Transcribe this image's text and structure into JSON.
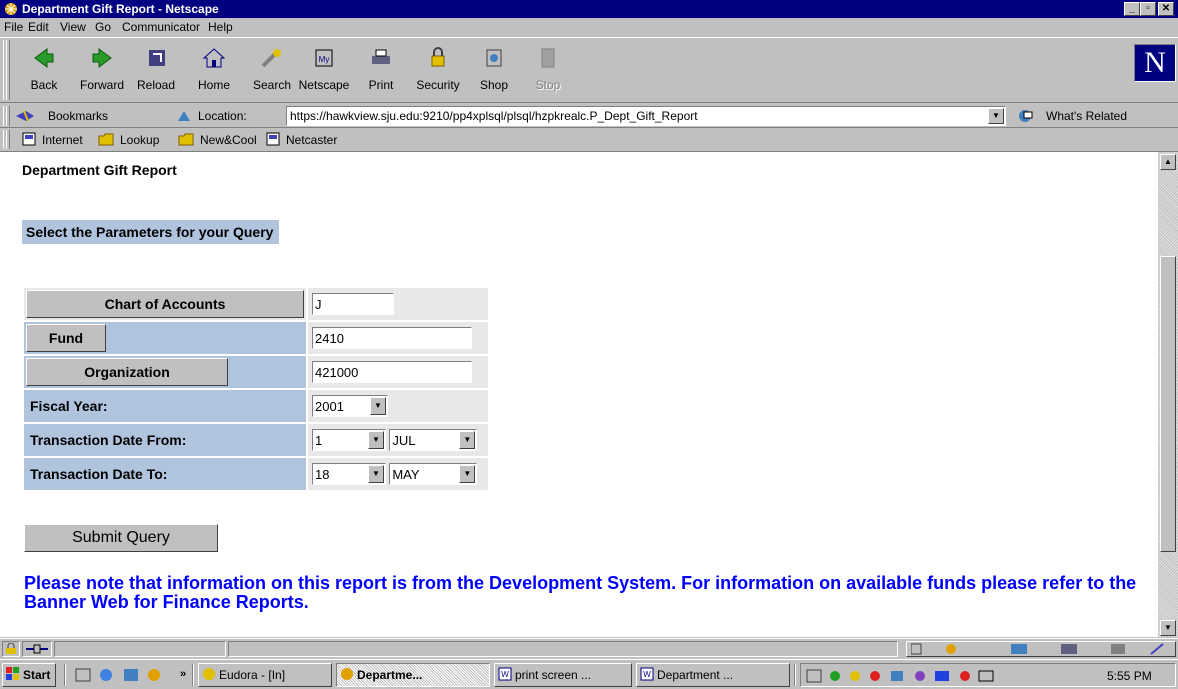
{
  "window": {
    "title": "Department Gift Report - Netscape"
  },
  "menu": [
    "File",
    "Edit",
    "View",
    "Go",
    "Communicator",
    "Help"
  ],
  "nav_buttons": [
    {
      "label": "Back",
      "icon": "back-arrow-icon"
    },
    {
      "label": "Forward",
      "icon": "forward-arrow-icon"
    },
    {
      "label": "Reload",
      "icon": "reload-icon"
    },
    {
      "label": "Home",
      "icon": "home-icon"
    },
    {
      "label": "Search",
      "icon": "search-icon"
    },
    {
      "label": "Netscape",
      "icon": "netscape-icon"
    },
    {
      "label": "Print",
      "icon": "print-icon"
    },
    {
      "label": "Security",
      "icon": "security-lock-icon"
    },
    {
      "label": "Shop",
      "icon": "shop-icon"
    },
    {
      "label": "Stop",
      "icon": "stop-icon"
    }
  ],
  "location": {
    "bookmarks_label": "Bookmarks",
    "location_label": "Location:",
    "url": "https://hawkview.sju.edu:9210/pp4xplsql/plsql/hzpkrealc.P_Dept_Gift_Report",
    "whats_related": "What's Related"
  },
  "personal_bar": [
    "Internet",
    "Lookup",
    "New&Cool",
    "Netcaster"
  ],
  "page": {
    "title": "Department Gift Report",
    "param_header": "Select the Parameters for your Query",
    "form": {
      "chart_label": "Chart of Accounts",
      "chart_value": "J",
      "fund_label": "Fund",
      "fund_value": "2410",
      "org_label": "Organization",
      "org_value": "421000",
      "fiscal_label": "Fiscal Year:",
      "fiscal_value": "2001",
      "from_label": "Transaction Date From:",
      "from_day": "1",
      "from_month": "JUL",
      "to_label": "Transaction Date To:",
      "to_day": "18",
      "to_month": "MAY"
    },
    "submit_label": "Submit Query",
    "note": "Please note that information on this report is from the Development System. For information on available funds please refer to the Banner Web for Finance Reports."
  },
  "taskbar": {
    "start": "Start",
    "chevron": "»",
    "tasks": [
      {
        "label": "Eudora - [In]",
        "active": false
      },
      {
        "label": "Departme...",
        "active": true
      },
      {
        "label": "print screen ...",
        "active": false
      },
      {
        "label": "Department ...",
        "active": false
      }
    ],
    "clock": "5:55 PM"
  }
}
